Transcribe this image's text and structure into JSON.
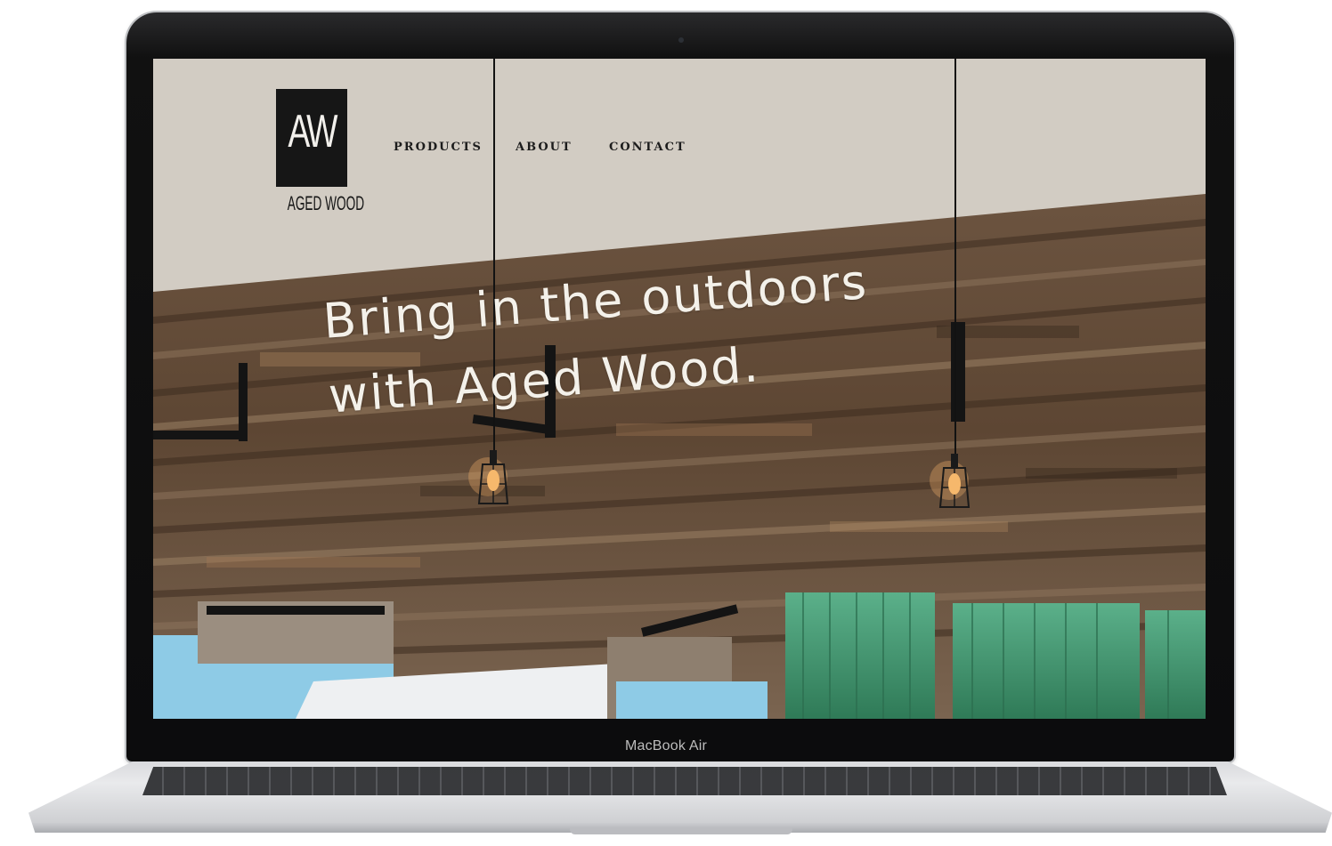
{
  "device": {
    "model_label": "MacBook Air"
  },
  "site": {
    "logo": {
      "mark": "AW",
      "caption": "AGED WOOD"
    },
    "nav": {
      "items": [
        {
          "label": "PRODUCTS"
        },
        {
          "label": "ABOUT"
        },
        {
          "label": "CONTACT"
        }
      ]
    },
    "hero": {
      "title_line1": "Bring in the outdoors",
      "title_line2": "with Aged Wood."
    }
  },
  "colors": {
    "header_background": "#d2ccc3",
    "wood_dark": "#4f3a2a",
    "wood_light": "#8a7058",
    "bench_blue": "#8ecbe6",
    "plant_green": "#3f9c73"
  },
  "icons": [
    "aged-wood-logo",
    "pendant-lamp-icon"
  ]
}
